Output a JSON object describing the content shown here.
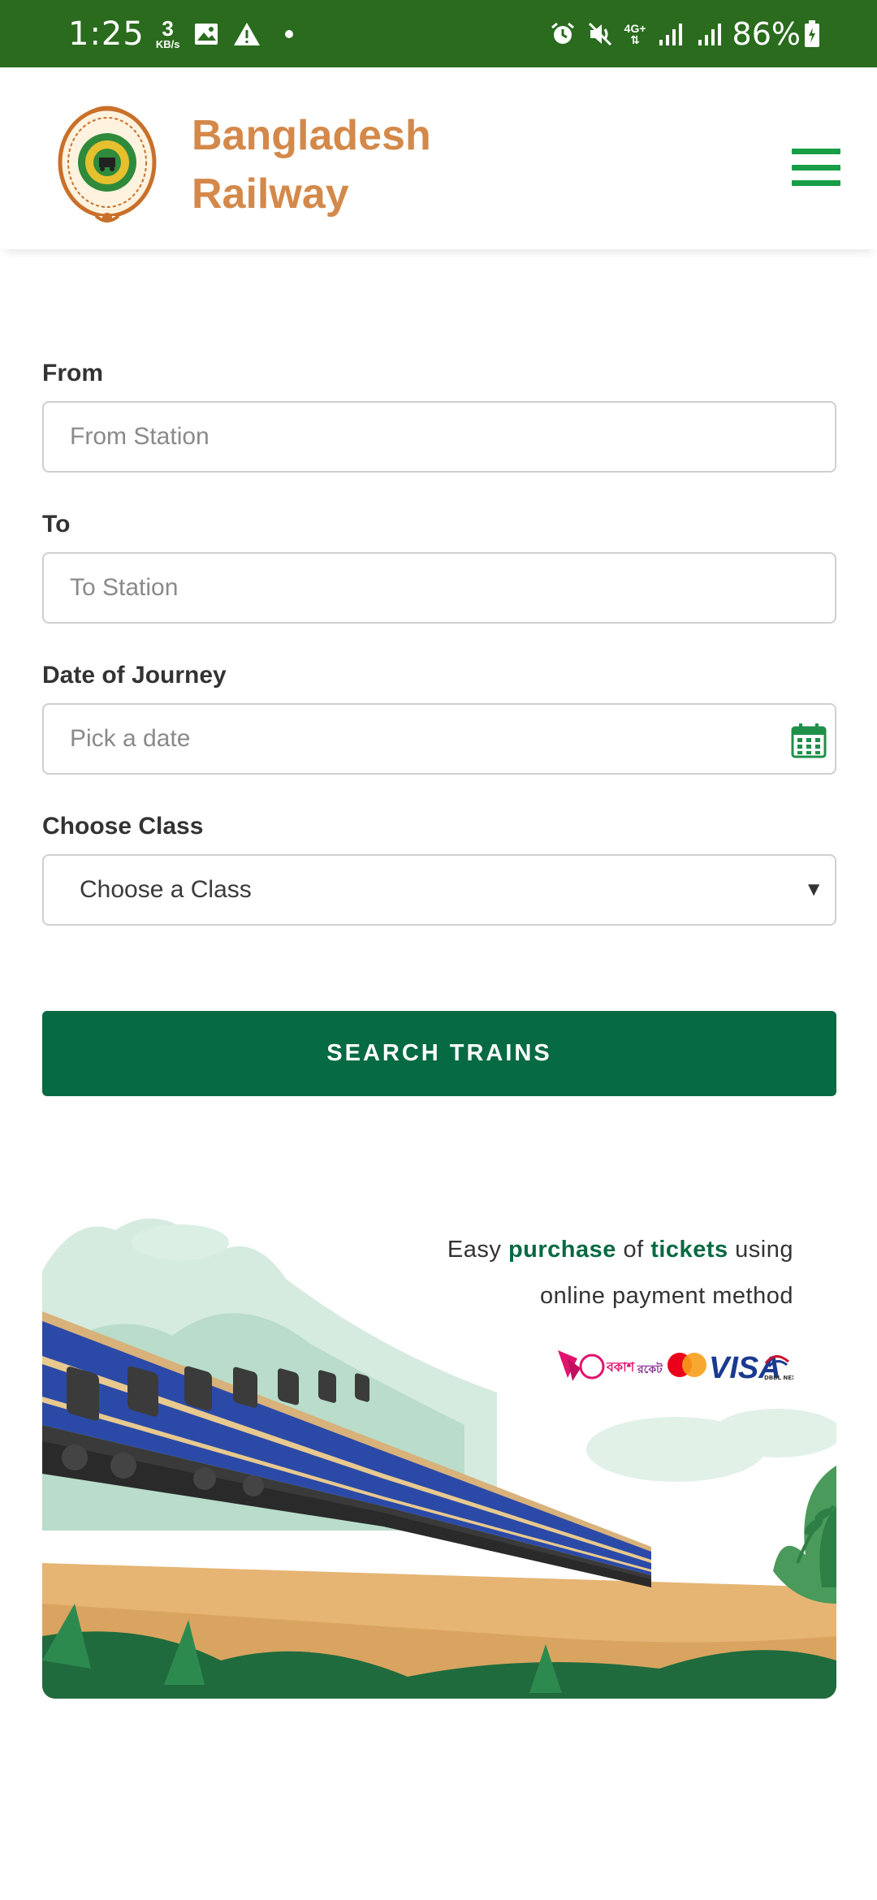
{
  "status_bar": {
    "time": "1:25",
    "speed_value": "3",
    "speed_unit": "KB/s",
    "network": "4G+",
    "battery": "86%"
  },
  "header": {
    "brand_line1": "Bangladesh",
    "brand_line2": "Railway",
    "logo_icon": "bangladesh-railway-emblem",
    "menu_icon": "hamburger-menu-icon"
  },
  "form": {
    "from_label": "From",
    "from_placeholder": "From Station",
    "to_label": "To",
    "to_placeholder": "To Station",
    "date_label": "Date of Journey",
    "date_placeholder": "Pick a date",
    "class_label": "Choose Class",
    "class_selected": "Choose a Class",
    "search_button": "SEARCH TRAINS"
  },
  "promo": {
    "line1_part1": "Easy ",
    "line1_highlight1": "purchase",
    "line1_part2": " of ",
    "line1_highlight2": "tickets",
    "line1_part3": " using",
    "line2": "online payment method",
    "payment_logos": [
      "bKash",
      "Rocket",
      "Mastercard",
      "VISA",
      "DBBL Nexus"
    ]
  },
  "colors": {
    "status_bar": "#2a6b1e",
    "brand": "#d4894a",
    "menu": "#179e46",
    "primary_button": "#066a42"
  }
}
